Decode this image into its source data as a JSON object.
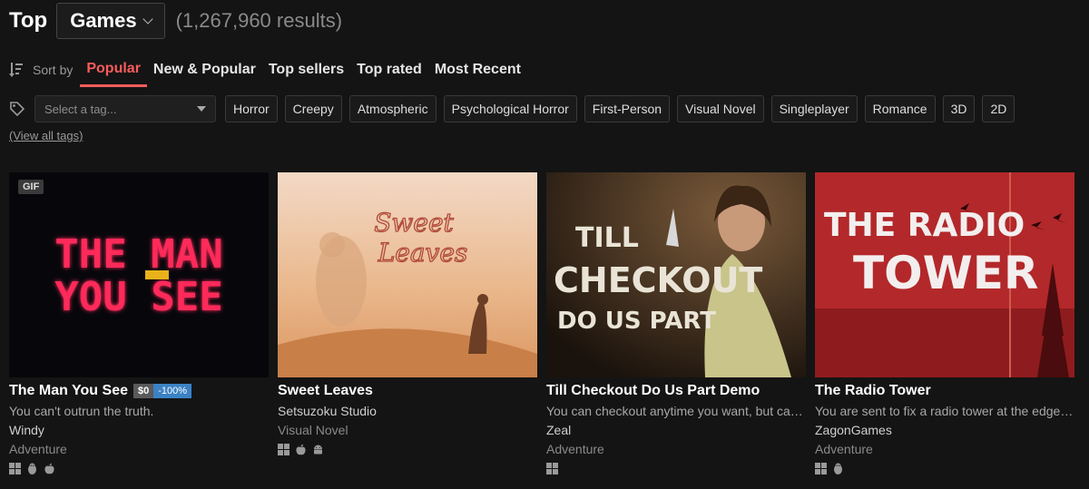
{
  "header": {
    "top_label": "Top",
    "category": "Games",
    "result_count": "(1,267,960 results)"
  },
  "sort": {
    "label": "Sort by",
    "tabs": [
      "Popular",
      "New & Popular",
      "Top sellers",
      "Top rated",
      "Most Recent"
    ],
    "active": "Popular"
  },
  "tags": {
    "placeholder": "Select a tag...",
    "chips": [
      "Horror",
      "Creepy",
      "Atmospheric",
      "Psychological Horror",
      "First-Person",
      "Visual Novel",
      "Singleplayer",
      "Romance",
      "3D",
      "2D"
    ],
    "view_all": "(View all tags)"
  },
  "games": [
    {
      "title": "The Man You See",
      "price": "$0",
      "discount": "-100%",
      "badge": "GIF",
      "description": "You can't outrun the truth.",
      "author": "Windy",
      "genre": "Adventure",
      "platforms": [
        "windows-icon",
        "linux-icon",
        "apple-icon"
      ],
      "art_text": [
        "THE MAN",
        "YOU SEE"
      ]
    },
    {
      "title": "Sweet Leaves",
      "description": "",
      "author": "Setsuzoku Studio",
      "genre": "Visual Novel",
      "platforms": [
        "windows-icon",
        "apple-icon",
        "android-icon"
      ],
      "art_text": [
        "Sweet",
        "Leaves"
      ]
    },
    {
      "title": "Till Checkout Do Us Part Demo",
      "description": "You can checkout anytime you want, but can never leave",
      "author": "Zeal",
      "genre": "Adventure",
      "platforms": [
        "windows-icon"
      ],
      "art_text": [
        "TILL",
        "CHECKOUT",
        "DO US PART"
      ]
    },
    {
      "title": "The Radio Tower",
      "description": "You are sent to fix a radio tower at the edge of the woods",
      "author": "ZagonGames",
      "genre": "Adventure",
      "platforms": [
        "windows-icon",
        "linux-icon"
      ],
      "art_text": [
        "THE RADIO",
        "TOWER"
      ]
    }
  ],
  "colors": {
    "background": "#141414",
    "accent": "#fa5c5c",
    "discount": "#3b82c4"
  }
}
